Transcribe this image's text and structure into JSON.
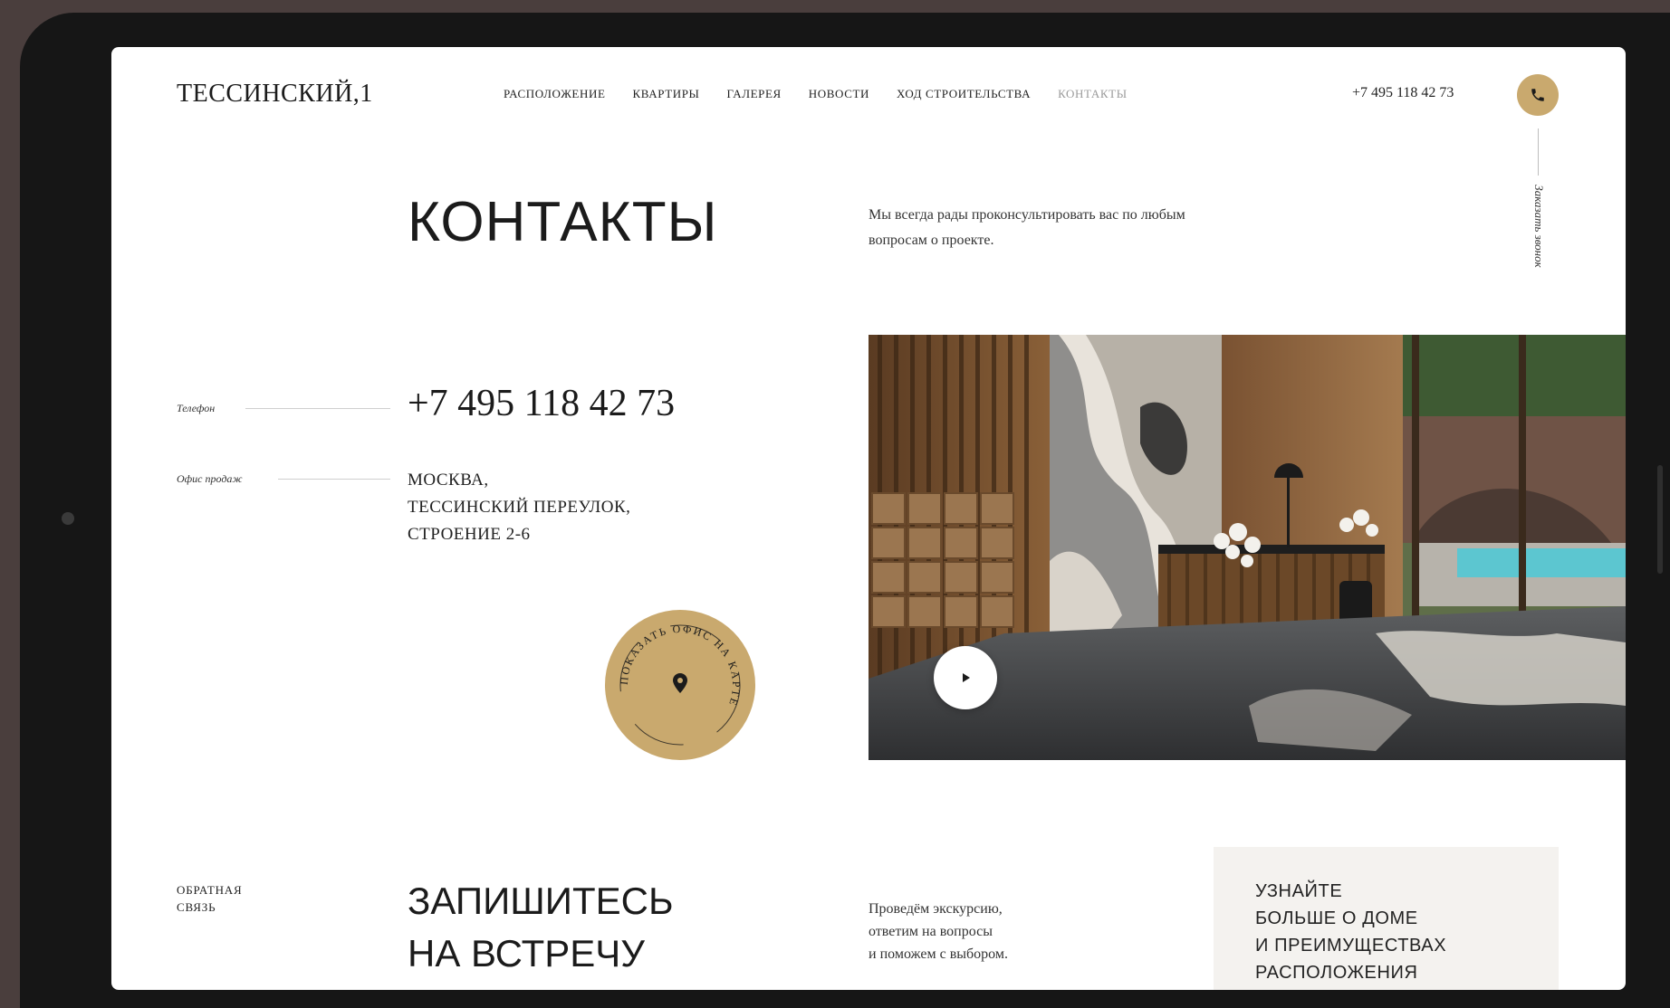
{
  "header": {
    "logo": "ТЕССИНСКИЙ,1",
    "nav": [
      {
        "label": "РАСПОЛОЖЕНИЕ",
        "active": false
      },
      {
        "label": "КВАРТИРЫ",
        "active": false
      },
      {
        "label": "ГАЛЕРЕЯ",
        "active": false
      },
      {
        "label": "НОВОСТИ",
        "active": false
      },
      {
        "label": "ХОД СТРОИТЕЛЬСТВА",
        "active": false
      },
      {
        "label": "КОНТАКТЫ",
        "active": true
      }
    ],
    "phone": "+7 495 118 42 73",
    "call_icon": "phone-icon",
    "vertical_label": "Заказать звонок"
  },
  "hero": {
    "title": "КОНТАКТЫ",
    "intro": "Мы всегда рады проконсультировать вас по любым вопросам о проекте."
  },
  "contacts": {
    "phone_label": "Телефон",
    "phone": "+7 495 118 42 73",
    "office_label": "Офис продаж",
    "address_lines": [
      "МОСКВА,",
      "ТЕССИНСКИЙ ПЕРЕУЛОК,",
      "СТРОЕНИЕ 2-6"
    ]
  },
  "map_badge": {
    "text": "ПОКАЗАТЬ ОФИС НА КАРТЕ",
    "icon": "map-pin-icon"
  },
  "media": {
    "play_icon": "play-icon"
  },
  "bottom": {
    "section_label": [
      "ОБРАТНАЯ",
      "СВЯЗЬ"
    ],
    "title_lines": [
      "ЗАПИШИТЕСЬ",
      "НА ВСТРЕЧУ"
    ],
    "tour_lines": [
      "Проведём экскурсию,",
      "ответим на вопросы",
      "и поможем с выбором."
    ],
    "learn_lines": [
      "УЗНАЙТЕ",
      "БОЛЬШЕ О ДОМЕ",
      "И ПРЕИМУЩЕСТВАХ",
      "РАСПОЛОЖЕНИЯ"
    ]
  },
  "colors": {
    "accent": "#c9a96e",
    "text": "#1b1b1b",
    "muted": "#9a9a9a",
    "panel": "#f4f2ef"
  }
}
